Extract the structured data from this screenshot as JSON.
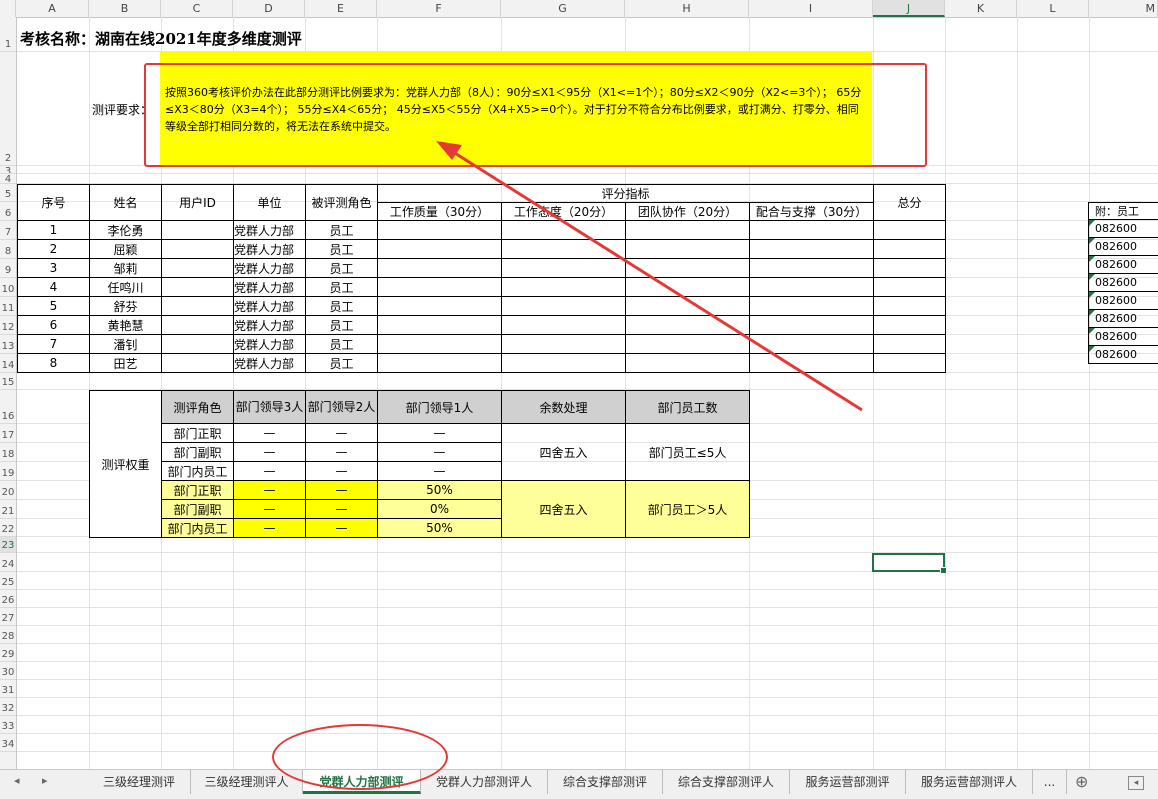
{
  "columns": [
    "A",
    "B",
    "C",
    "D",
    "E",
    "F",
    "G",
    "H",
    "I",
    "J",
    "K",
    "L",
    "M"
  ],
  "rows": [
    "1",
    "2",
    "3",
    "4",
    "5",
    "6",
    "7",
    "8",
    "9",
    "10",
    "11",
    "12",
    "13",
    "14",
    "15",
    "16",
    "17",
    "18",
    "19",
    "20",
    "21",
    "22",
    "23",
    "24",
    "25",
    "26",
    "27",
    "28",
    "29",
    "30",
    "31",
    "32",
    "33",
    "34"
  ],
  "title": "考核名称：湖南在线2021年度多维度测评",
  "requirement": {
    "label": "测评要求：",
    "text": "按照360考核评价办法在此部分测评比例要求为：党群人力部（8人）：90分≤X1＜95分（X1<=1个）；80分≤X2＜90分（X2<=3个）； 65分≤X3＜80分（X3=4个）； 55分≤X4＜65分； 45分≤X5＜55分（X4+X5>=0个）。对于打分不符合分布比例要求，或打满分、打零分、相同等级全部打相同分数的，将无法在系统中提交。"
  },
  "main_table": {
    "headers": {
      "seq": "序号",
      "name": "姓名",
      "user_id": "用户ID",
      "unit": "单位",
      "role": "被评测角色",
      "score_indicators": "评分指标",
      "quality": "工作质量（30分）",
      "attitude": "工作态度（20分）",
      "teamwork": "团队协作（20分）",
      "support": "配合与支撑（30分）",
      "total": "总分"
    },
    "rows": [
      {
        "seq": "1",
        "name": "李伦勇",
        "unit": "党群人力部",
        "role": "员工"
      },
      {
        "seq": "2",
        "name": "屈颖",
        "unit": "党群人力部",
        "role": "员工"
      },
      {
        "seq": "3",
        "name": "邹莉",
        "unit": "党群人力部",
        "role": "员工"
      },
      {
        "seq": "4",
        "name": "任鸣川",
        "unit": "党群人力部",
        "role": "员工"
      },
      {
        "seq": "5",
        "name": "舒芬",
        "unit": "党群人力部",
        "role": "员工"
      },
      {
        "seq": "6",
        "name": "黄艳慧",
        "unit": "党群人力部",
        "role": "员工"
      },
      {
        "seq": "7",
        "name": "潘钊",
        "unit": "党群人力部",
        "role": "员工"
      },
      {
        "seq": "8",
        "name": "田艺",
        "unit": "党群人力部",
        "role": "员工"
      }
    ]
  },
  "side_list": {
    "header": "附：员工",
    "values": [
      "082600",
      "082600",
      "082600",
      "082600",
      "082600",
      "082600",
      "082600",
      "082600"
    ]
  },
  "weight_table": {
    "label": "测评权重",
    "headers": {
      "role": "测评角色",
      "lead3": "部门领导3人",
      "lead2": "部门领导2人",
      "lead1": "部门领导1人",
      "rounding": "余数处理",
      "staff": "部门员工数"
    },
    "group1": {
      "rows": [
        {
          "role": "部门正职",
          "lead3": "—",
          "lead2": "—",
          "lead1": "—"
        },
        {
          "role": "部门副职",
          "lead3": "—",
          "lead2": "—",
          "lead1": "—"
        },
        {
          "role": "部门内员工",
          "lead3": "—",
          "lead2": "—",
          "lead1": "—"
        }
      ],
      "rounding": "四舍五入",
      "staff": "部门员工≤5人"
    },
    "group2": {
      "rows": [
        {
          "role": "部门正职",
          "lead3": "—",
          "lead2": "—",
          "lead1": "50%"
        },
        {
          "role": "部门副职",
          "lead3": "—",
          "lead2": "—",
          "lead1": "0%"
        },
        {
          "role": "部门内员工",
          "lead3": "—",
          "lead2": "—",
          "lead1": "50%"
        }
      ],
      "rounding": "四舍五入",
      "staff": "部门员工＞5人"
    }
  },
  "tabs": [
    {
      "label": "三级经理测评"
    },
    {
      "label": "三级经理测评人"
    },
    {
      "label": "党群人力部测评",
      "active": true
    },
    {
      "label": "党群人力部测评人"
    },
    {
      "label": "综合支撑部测评"
    },
    {
      "label": "综合支撑部测评人"
    },
    {
      "label": "服务运营部测评"
    },
    {
      "label": "服务运营部测评人"
    }
  ],
  "tab_more": "...",
  "tab_add": "⊕",
  "colors": {
    "highlight": "#ffff00",
    "light_yellow": "#ffff99",
    "header_gray": "#d0d0d0",
    "excel_green": "#217346",
    "annotation_red": "#e53935"
  }
}
